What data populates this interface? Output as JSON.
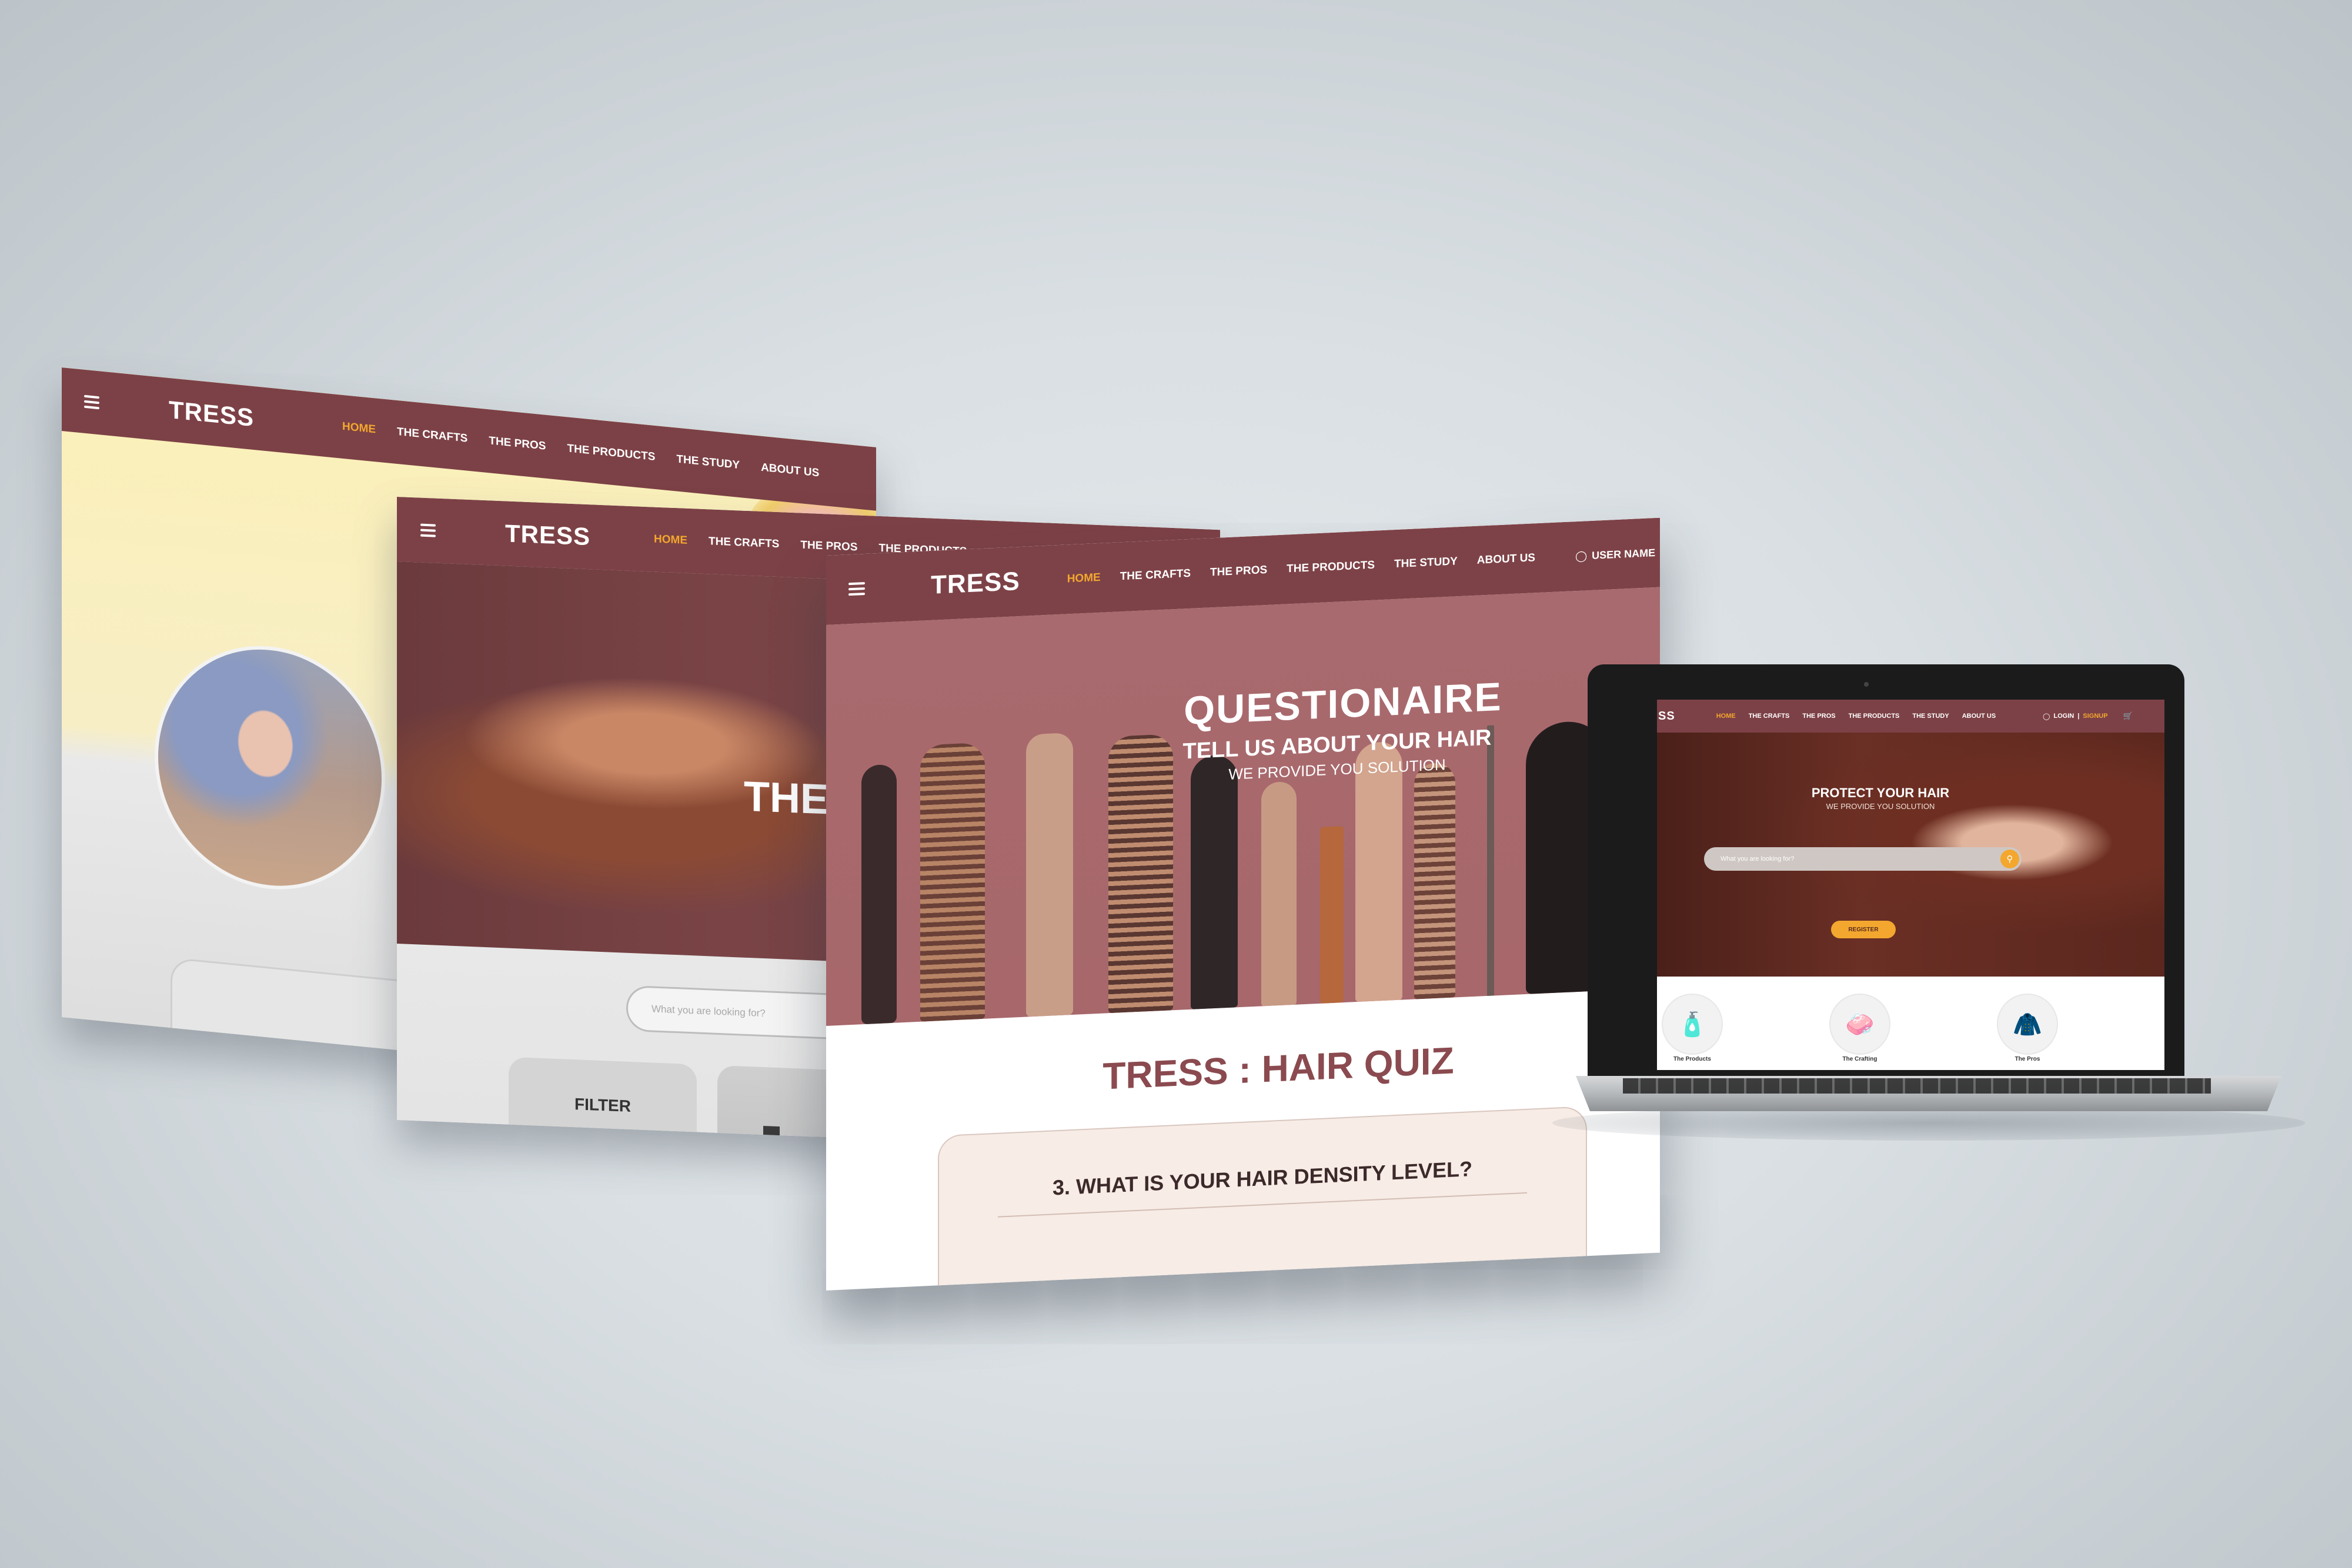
{
  "site": {
    "logo": "TRESS",
    "nav": [
      "HOME",
      "THE CRAFTS",
      "THE PROS",
      "THE PRODUCTS",
      "THE STUDY",
      "ABOUT US"
    ],
    "login": "LOGIN",
    "separator": "|",
    "signup": "SIGNUP",
    "user_name": "USER NAME",
    "cart_icon": "cart-icon",
    "menu_icon": "hamburger-menu-icon"
  },
  "panel_b": {
    "hero_title": "THE C",
    "search_placeholder": "What you are looking for?",
    "filter_label": "FILTER"
  },
  "panel_c": {
    "hero_title": "QUESTIONAIRE",
    "hero_subtitle": "TELL US ABOUT YOUR HAIR",
    "hero_tagline": "WE PROVIDE YOU SOLUTION",
    "quiz_heading": "TRESS : HAIR QUIZ",
    "question": "3. WHAT IS YOUR HAIR DENSITY LEVEL?"
  },
  "laptop": {
    "logo_fragment": "SS",
    "hero_heading": "PROTECT YOUR HAIR",
    "hero_subheading": "WE PROVIDE YOU SOLUTION",
    "search_placeholder": "What you are looking for?",
    "register_label": "REGISTER",
    "categories": [
      "The Products",
      "The Crafting",
      "The Pros"
    ]
  },
  "colors": {
    "brand_header": "#7c4146",
    "accent": "#f3a72e",
    "quiz_heading": "#8a4a4f",
    "question_card": "#f7ece6"
  }
}
